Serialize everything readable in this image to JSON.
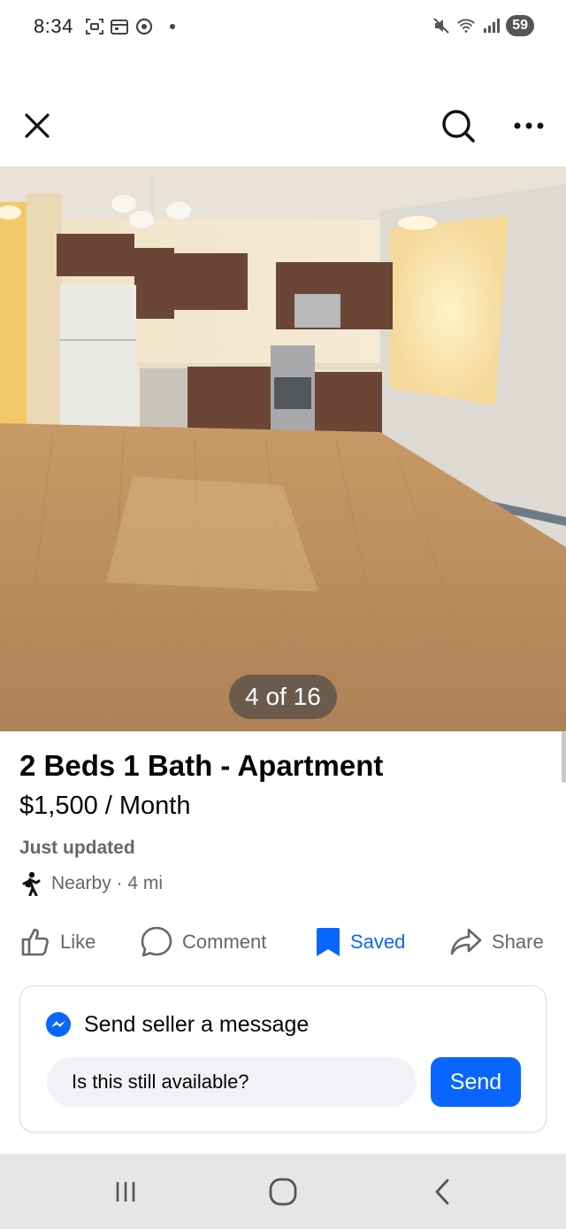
{
  "status_bar": {
    "time": "8:34",
    "battery": "59",
    "icons_left": [
      "screenshot-icon",
      "calendar-icon",
      "chrome-icon",
      "notification-dot"
    ],
    "icons_right": [
      "mute-icon",
      "wifi-icon",
      "signal-icon"
    ]
  },
  "top_nav": {
    "close": "close-icon",
    "search": "search-icon",
    "more": "more-icon"
  },
  "photo": {
    "counter": "4 of 16"
  },
  "listing": {
    "title": "2 Beds 1 Bath - Apartment",
    "price": "$1,500 / Month",
    "updated": "Just updated",
    "distance": "Nearby · 4 mi"
  },
  "actions": {
    "like": "Like",
    "comment": "Comment",
    "saved": "Saved",
    "share": "Share"
  },
  "message": {
    "heading": "Send seller a message",
    "input_value": "Is this still available?",
    "send": "Send"
  },
  "colors": {
    "accent": "#0866ff",
    "secondary_text": "#65676b",
    "input_bg": "#f0f2f5"
  }
}
